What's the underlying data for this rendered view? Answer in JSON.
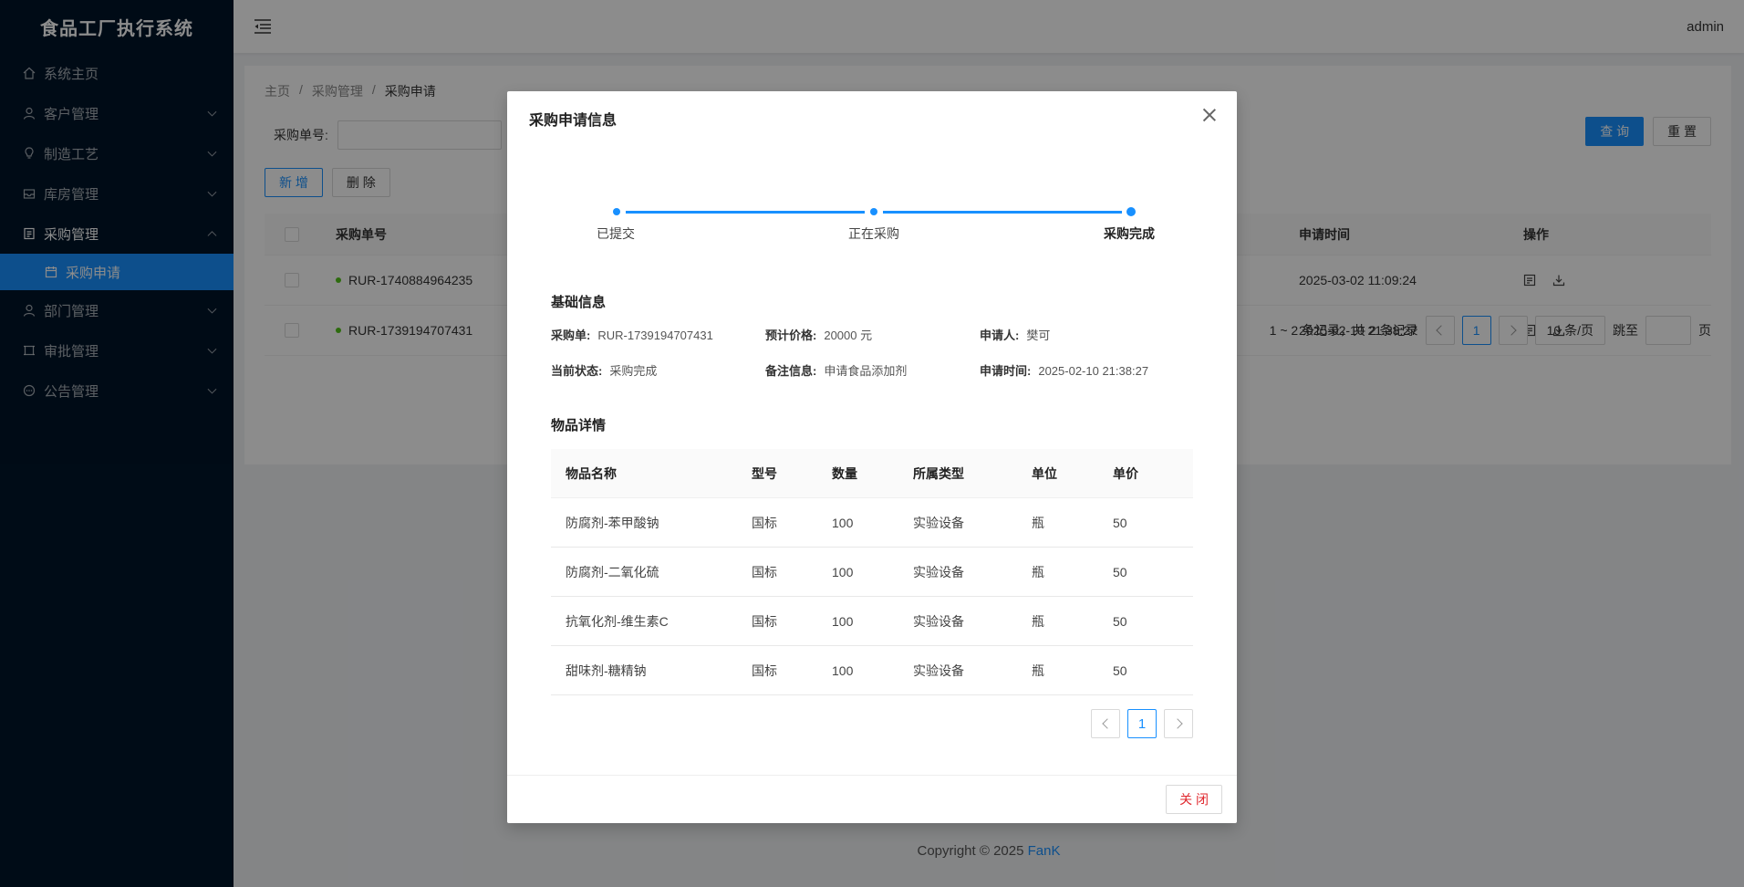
{
  "app": {
    "title": "食品工厂执行系统"
  },
  "header": {
    "user": "admin"
  },
  "sidebar": {
    "items": [
      {
        "label": "系统主页",
        "icon": "home-icon"
      },
      {
        "label": "客户管理",
        "icon": "user-icon"
      },
      {
        "label": "制造工艺",
        "icon": "bulb-icon"
      },
      {
        "label": "库房管理",
        "icon": "inbox-icon"
      },
      {
        "label": "采购管理",
        "icon": "file-icon",
        "expanded": true,
        "children": [
          {
            "label": "采购申请",
            "icon": "calendar-icon",
            "active": true
          }
        ]
      },
      {
        "label": "部门管理",
        "icon": "user-icon"
      },
      {
        "label": "审批管理",
        "icon": "frame-icon"
      },
      {
        "label": "公告管理",
        "icon": "message-icon"
      }
    ]
  },
  "breadcrumb": [
    "主页",
    "采购管理",
    "采购申请"
  ],
  "filter": {
    "label": "采购单号:",
    "query": "查 询",
    "reset": "重 置"
  },
  "actions": {
    "add": "新 增",
    "delete": "删 除"
  },
  "table": {
    "columns": {
      "no": "采购单号",
      "time": "申请时间",
      "op": "操作"
    },
    "rows": [
      {
        "no": "RUR-1740884964235",
        "time": "2025-03-02 11:09:24"
      },
      {
        "no": "RUR-1739194707431",
        "time": "2025-02-10 21:38:27"
      }
    ]
  },
  "pager": {
    "summary": "1 ~ 2 条记录，共 2 条记录",
    "page": "1",
    "size": "10 条/页",
    "jump": "跳至",
    "unit": "页"
  },
  "footer": {
    "copyright": "Copyright © 2025",
    "author": "FanK"
  },
  "modal": {
    "title": "采购申请信息",
    "steps": [
      "已提交",
      "正在采购",
      "采购完成"
    ],
    "basic_title": "基础信息",
    "info": {
      "order_k": "采购单:",
      "order_v": "RUR-1739194707431",
      "price_k": "预计价格:",
      "price_v": "20000 元",
      "applicant_k": "申请人:",
      "applicant_v": "樊可",
      "status_k": "当前状态:",
      "status_v": "采购完成",
      "remark_k": "备注信息:",
      "remark_v": "申请食品添加剂",
      "time_k": "申请时间:",
      "time_v": "2025-02-10 21:38:27"
    },
    "items_title": "物品详情",
    "item_columns": [
      "物品名称",
      "型号",
      "数量",
      "所属类型",
      "单位",
      "单价"
    ],
    "items": [
      [
        "防腐剂-苯甲酸钠",
        "国标",
        "100",
        "实验设备",
        "瓶",
        "50"
      ],
      [
        "防腐剂-二氧化硫",
        "国标",
        "100",
        "实验设备",
        "瓶",
        "50"
      ],
      [
        "抗氧化剂-维生素C",
        "国标",
        "100",
        "实验设备",
        "瓶",
        "50"
      ],
      [
        "甜味剂-糖精钠",
        "国标",
        "100",
        "实验设备",
        "瓶",
        "50"
      ]
    ],
    "page": "1",
    "close": "关 闭"
  },
  "colors": {
    "primary": "#1890ff",
    "sidebar": "#001529",
    "danger": "#e0282e"
  }
}
